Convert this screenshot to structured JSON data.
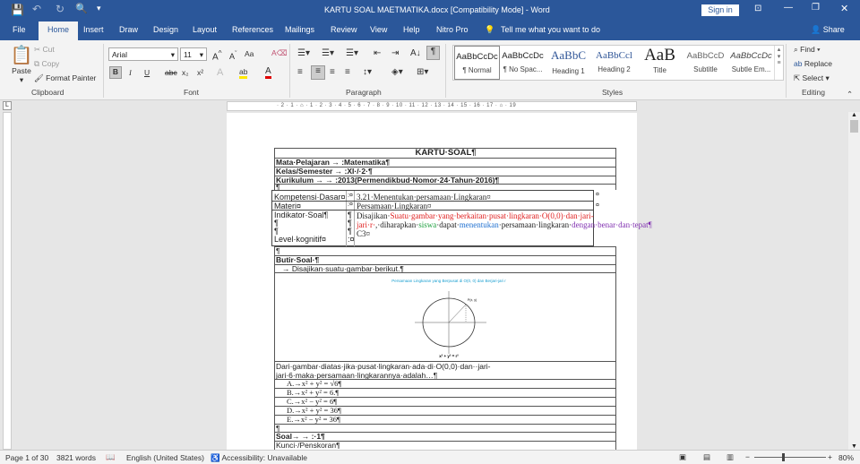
{
  "window": {
    "title": "KARTU SOAL MAETMATIKA.docx [Compatibility Mode]  -  Word",
    "sign_in": "Sign in"
  },
  "tabs": [
    "File",
    "Home",
    "Insert",
    "Draw",
    "Design",
    "Layout",
    "References",
    "Mailings",
    "Review",
    "View",
    "Help",
    "Nitro Pro"
  ],
  "tell_me": "Tell me what you want to do",
  "share": "Share",
  "clipboard": {
    "paste": "Paste",
    "cut": "Cut",
    "copy": "Copy",
    "format_painter": "Format Painter",
    "label": "Clipboard"
  },
  "font": {
    "name": "Arial",
    "size": "11",
    "label": "Font",
    "bold": "B",
    "italic": "I",
    "underline": "U",
    "strike": "abc",
    "sub": "x₂",
    "sup": "x²",
    "case": "Aa"
  },
  "paragraph": {
    "label": "Paragraph"
  },
  "styles": {
    "label": "Styles",
    "items": [
      {
        "preview": "AaBbCcDc",
        "name": "¶ Normal"
      },
      {
        "preview": "AaBbCcDc",
        "name": "¶ No Spac..."
      },
      {
        "preview": "AaBbC",
        "name": "Heading 1"
      },
      {
        "preview": "AaBbCcl",
        "name": "Heading 2"
      },
      {
        "preview": "AaB",
        "name": "Title"
      },
      {
        "preview": "AaBbCcD",
        "name": "Subtitle"
      },
      {
        "preview": "AaBbCcDc",
        "name": "Subtle Em..."
      }
    ]
  },
  "editing": {
    "label": "Editing",
    "find": "Find",
    "replace": "Replace",
    "select": "Select"
  },
  "ruler": "· 2 · 1 · ⌂ · 1 · 2 · 3 · 4 · 5 · 6 · 7 · 8 · 9 · 10 · 11 · 12 · 13 · 14 · 15 · 16 · 17 · ⌂ · 19",
  "doc": {
    "title": "KARTU·SOAL¶",
    "mata": "Mata·Pelajaran  →  :Matematika¶",
    "kelas": "Kelas/Semester  →  :XI·/·2·¶",
    "kurikulum": "Kurikulum →   →   :2013(Permendikbud·Nomor·24·Tahun·2016)¶",
    "pilcrow": "¶",
    "kd_label": "Kompetensi·Dasar¤",
    "kd_value": "3.21·Menentukan·persamaan·Lingkaran¤",
    "materi_label": "Materi¤",
    "materi_value": "Persamaan·Lingkaran¤",
    "indikator_label": "Indikator·Soal¶",
    "level_label": "Level·kognitif¤",
    "ind_1": "Disajikan·",
    "ind_2": "Suatu·gambar·yang·berkaitan·pusat·lingkaran·O(0,0)·dan·jari-jari·r·",
    "ind_3": ",·diharapkan·",
    "ind_4": "siswa",
    "ind_5": "·dapat·",
    "ind_6": "menentukan",
    "ind_7": "·persamaan·lingkaran·",
    "ind_8": "dengan·benar·dan·tepat¶",
    "level_value": "C3¤",
    "colon": ":¤",
    "butir": "Butir·Soal·¶",
    "disajikan": "  →   Disajikan·suatu·gambar·berikut.¶",
    "figure_title": "Persamaan Lingkaran yang Berpusat di O(0, 0) dan Berjari-jari r",
    "figure_eq": "x² + y² = r²",
    "figure_point": "P(x, y)",
    "question": "Dari·gambar·diatas·jika·pusat·lingkaran·ada·di·O(0,0)·dan··jari-jari·6·maka·persamaan·lingkarannya·adalah…¶",
    "options": [
      "A.→x² + y² = √6¶",
      "B.→x² + y² = 6.¶",
      "C.→x² − y² = 6¶",
      "D.→x² + y² = 36¶",
      "E.→x² − y² = 36¶"
    ],
    "soal": "Soal→    →    :·1¶",
    "kunci": "Kunci·/Penskoran¶"
  },
  "status": {
    "page": "Page 1 of 30",
    "words": "3821 words",
    "language": "English (United States)",
    "accessibility": "Accessibility: Unavailable",
    "zoom": "80%"
  }
}
